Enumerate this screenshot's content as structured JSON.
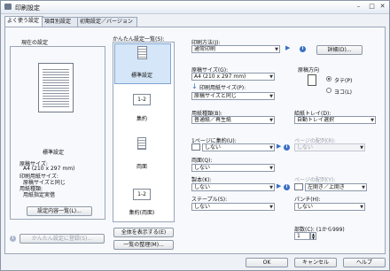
{
  "window": {
    "title": "印刷設定"
  },
  "tabs": [
    {
      "label": "よく使う設定"
    },
    {
      "label": "項目別設定"
    },
    {
      "label": "初期設定／バージョン"
    }
  ],
  "current_settings": {
    "heading": "現在の設定",
    "preview_name": "標準設定",
    "details": [
      "原稿サイズ:",
      "A4 (210 x 297 mm)",
      "印刷用紙サイズ:",
      "原稿サイズと同じ",
      "用紙種類:",
      "用紙指定実借"
    ],
    "list_button": "設定内容一覧(L)...",
    "register_button": "かんたん設定に登録(S)..."
  },
  "presets": {
    "heading": "かんたん設定一覧(S):",
    "items": [
      {
        "label": "標準設定"
      },
      {
        "label": "集約",
        "glyph": "1-2"
      },
      {
        "label": "両面"
      },
      {
        "label": "集約(両面)",
        "glyph": "1-2"
      }
    ],
    "show_all_button": "全体を表示する(E)",
    "organize_button": "一覧の整理(M)..."
  },
  "print_method": {
    "label": "印刷方法(J):",
    "value": "通常印刷",
    "details_button": "詳細(D)..."
  },
  "paper": {
    "original_size_label": "原稿サイズ(G):",
    "original_size_value": "A4 (210 x 297 mm)",
    "print_size_label": "印刷用紙サイズ(P):",
    "print_size_value": "原稿サイズと同じ",
    "type_label": "用紙種類(B):",
    "type_value": "普通紙／再生紙",
    "tray_label": "給紙トレイ(D):",
    "tray_value": "自動トレイ選択"
  },
  "orientation": {
    "label": "原稿方向",
    "portrait": "タテ(P)",
    "landscape": "ヨコ(L)",
    "selected": "portrait"
  },
  "layout": {
    "pages_per_sheet_label": "1ページに集約(U):",
    "pages_per_sheet_value": "しない",
    "page_order_label": "ページの配列(R):",
    "page_order_value": "しない",
    "duplex_label": "両面(Q):",
    "duplex_value": "しない",
    "binding_label": "製本(K):",
    "binding_value": "しない",
    "binding_order_label": "ページの配列(Y):",
    "binding_order_value": "左開き／上開き",
    "staple_label": "ステープル(S):",
    "staple_value": "しない",
    "punch_label": "パンチ(H):",
    "punch_value": "しない"
  },
  "copies": {
    "label": "部数(C): (1から999)",
    "value": "1"
  },
  "footer": {
    "ok": "OK",
    "cancel": "キャンセル",
    "help": "ヘルプ"
  }
}
